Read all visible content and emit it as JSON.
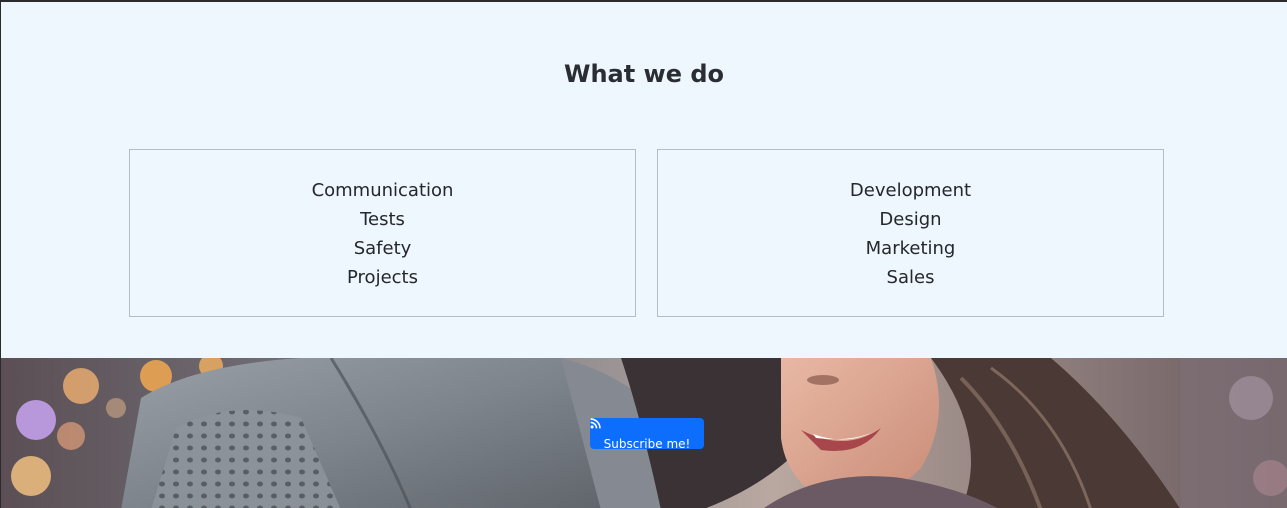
{
  "services_section": {
    "title": "What we do",
    "left_column": {
      "items": [
        "Communication",
        "Tests",
        "Safety",
        "Projects"
      ]
    },
    "right_column": {
      "items": [
        "Development",
        "Design",
        "Marketing",
        "Sales"
      ]
    }
  },
  "hero": {
    "image": "couple-embracing-photo",
    "subscribe_button": {
      "icon": "rss-icon",
      "label": "Subscribe me!"
    }
  },
  "colors": {
    "section_background": "#eef6fe",
    "box_border": "#b6bcc3",
    "button_primary": "#0d6efd",
    "text_dark": "#2a2d33"
  }
}
